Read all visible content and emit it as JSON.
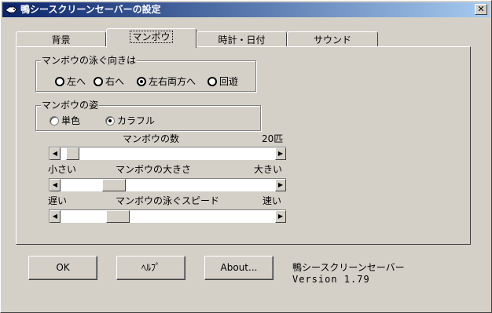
{
  "window": {
    "title": "鴨シースクリーンセーバーの設定",
    "close_label": "✕"
  },
  "tabs": [
    {
      "label": "背景"
    },
    {
      "label": "マンボウ"
    },
    {
      "label": "時計・日付"
    },
    {
      "label": "サウンド"
    }
  ],
  "active_tab_index": 1,
  "direction_group": {
    "label": "マンボウの泳ぐ向きは",
    "options": [
      "左へ",
      "右へ",
      "左右両方へ",
      "回遊"
    ],
    "selected": "左右両方へ"
  },
  "figure_group": {
    "label": "マンボウの姿",
    "options": [
      "単色",
      "カラフル"
    ],
    "selected": "カラフル"
  },
  "count_slider": {
    "label": "マンボウの数",
    "value_label": "20匹",
    "position": 0.03
  },
  "size_slider": {
    "label": "マンボウの大きさ",
    "min_label": "小さい",
    "max_label": "大きい",
    "position": 0.22
  },
  "speed_slider": {
    "label": "マンボウの泳ぐスピード",
    "min_label": "遅い",
    "max_label": "速い",
    "position": 0.24
  },
  "buttons": {
    "ok": "OK",
    "help": "ﾍﾙﾌﾟ",
    "about": "About..."
  },
  "about": {
    "name": "鴨シースクリーンセーバー",
    "version": "Version 1.79"
  }
}
